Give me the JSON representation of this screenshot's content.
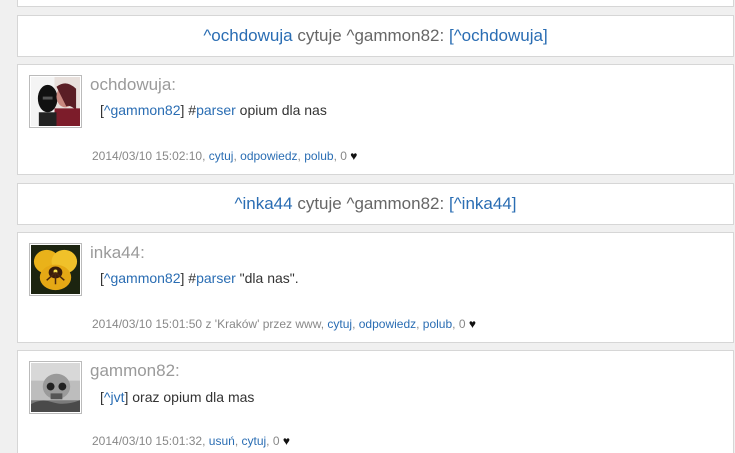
{
  "quotes": [
    {
      "author": "^ochdowuja",
      "verb": "cytuje",
      "target": "^gammon82",
      "colon": ":",
      "link": "[^ochdowuja]"
    },
    {
      "author": "^inka44",
      "verb": "cytuje",
      "target": "^gammon82",
      "colon": ":",
      "link": "[^inka44]"
    }
  ],
  "posts": [
    {
      "author": "ochdowuja:",
      "msg_prefix": "[",
      "mention": "^gammon82",
      "msg_mid": "] #",
      "tag": "parser",
      "msg_rest": " opium dla nas",
      "meta_time": "2014/03/10 15:02:10, ",
      "action1": "cytuj",
      "action2": "odpowiedz",
      "action3": "polub",
      "likes": "0"
    },
    {
      "author": "inka44:",
      "msg_prefix": "[",
      "mention": "^gammon82",
      "msg_mid": "] #",
      "tag": "parser",
      "msg_rest": " \"dla nas\".",
      "meta_time": "2014/03/10 15:01:50 z 'Kraków' przez www, ",
      "action1": "cytuj",
      "action2": "odpowiedz",
      "action3": "polub",
      "likes": "0"
    },
    {
      "author": "gammon82:",
      "msg_prefix": "[",
      "mention": "^jvt",
      "msg_rest": "] oraz opium dla mas",
      "meta_time": "2014/03/10 15:01:32, ",
      "action1": "usuń",
      "action2": "cytuj",
      "likes": "0"
    }
  ],
  "colors": {
    "link": "#2a6db3",
    "author": "#9a9a9a",
    "meta": "#888888"
  },
  "icons": {
    "like": "heart-icon"
  }
}
